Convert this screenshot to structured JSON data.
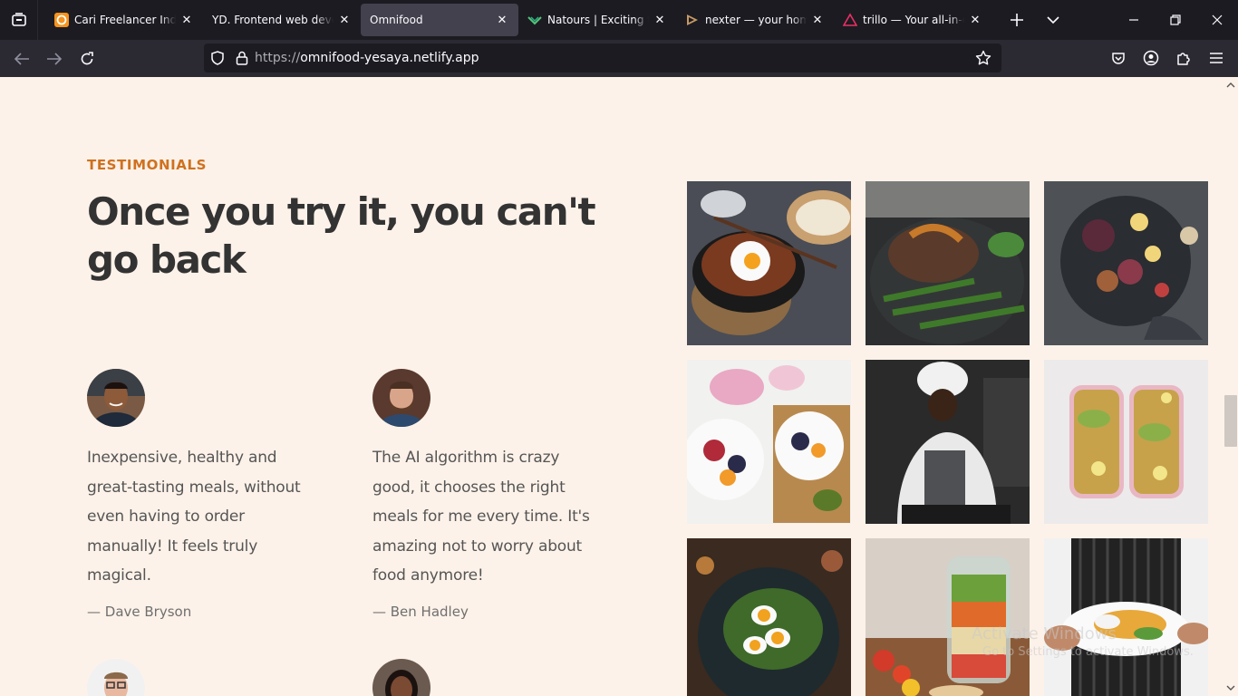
{
  "browser": {
    "tabs": [
      {
        "title": "Cari Freelancer Indonesia",
        "favicon": "projects-favicon",
        "active": false
      },
      {
        "title": "YD. Frontend web developer",
        "favicon": "none",
        "active": false
      },
      {
        "title": "Omnifood",
        "favicon": "none",
        "active": true
      },
      {
        "title": "Natours | Exciting tours",
        "favicon": "natours-favicon",
        "active": false
      },
      {
        "title": "nexter — your home, your",
        "favicon": "nexter-favicon",
        "active": false
      },
      {
        "title": "trillo — Your all-in-one",
        "favicon": "trillo-favicon",
        "active": false
      }
    ],
    "url_protocol": "https://",
    "url_host": "omnifood-yesaya.netlify.app",
    "colors": {
      "tabbar": "#1c1b22",
      "toolbar": "#2b2a33",
      "active_tab": "#42414d"
    }
  },
  "section": {
    "subheading": "Testimonials",
    "heading": "Once you try it, you can't go back",
    "accent_color": "#cf711f"
  },
  "testimonials": [
    {
      "quote": "Inexpensive, healthy and great-tasting meals, without even having to order manually! It feels truly magical.",
      "name": "— Dave Bryson"
    },
    {
      "quote": "The AI algorithm is crazy good, it chooses the right meals for me every time. It's amazing not to worry about food anymore!",
      "name": "— Ben Hadley"
    }
  ],
  "gallery": {
    "photos": [
      "bibimbap-photo",
      "steak-photo",
      "figs-platter-photo",
      "fruit-bowls-photo",
      "chef-photo",
      "meal-prep-photo",
      "egg-salad-photo",
      "salad-jar-photo",
      "chef-plate-photo"
    ]
  },
  "watermark": {
    "line1": "Activate Windows",
    "line2": "Go to Settings to activate Windows."
  }
}
